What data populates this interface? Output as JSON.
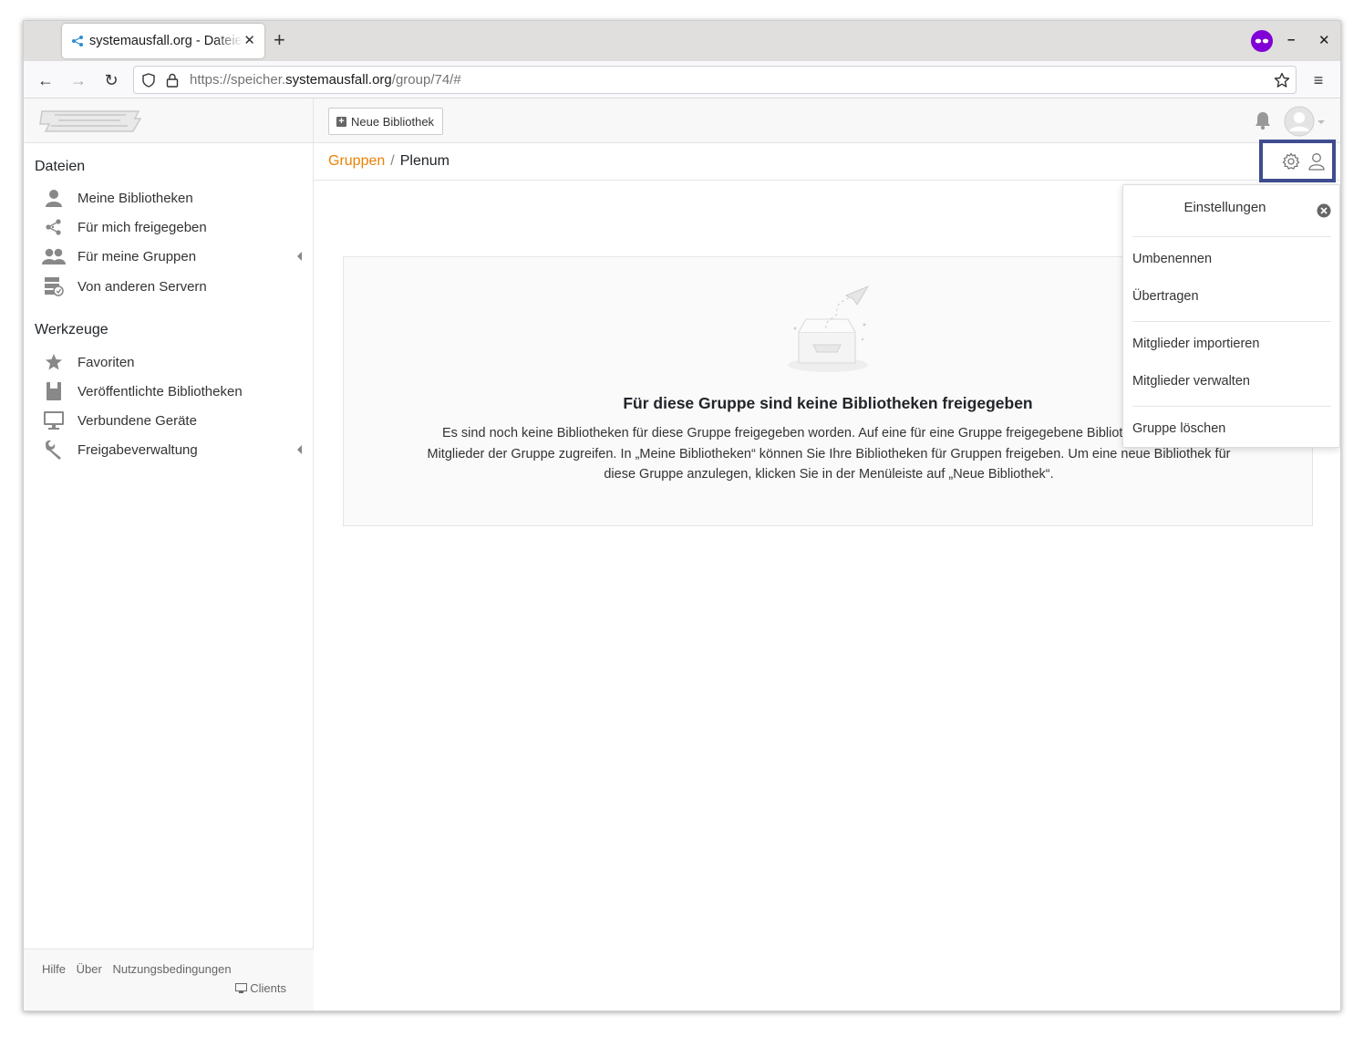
{
  "browser": {
    "tab_title": "systemausfall.org - Dateien",
    "url_prefix": "https://speicher.",
    "url_host": "systemausfall.org",
    "url_path": "/group/74/#"
  },
  "topbar": {
    "logo_alt": "systemausfall",
    "new_library_label": "Neue Bibliothek"
  },
  "sidebar": {
    "files_heading": "Dateien",
    "files_items": [
      {
        "label": "Meine Bibliotheken",
        "icon": "user-icon"
      },
      {
        "label": "Für mich freigegeben",
        "icon": "share-icon"
      },
      {
        "label": "Für meine Gruppen",
        "icon": "group-icon"
      },
      {
        "label": "Von anderen Servern",
        "icon": "server-icon"
      }
    ],
    "tools_heading": "Werkzeuge",
    "tools_items": [
      {
        "label": "Favoriten",
        "icon": "star-icon"
      },
      {
        "label": "Veröffentlichte Bibliotheken",
        "icon": "book-icon"
      },
      {
        "label": "Verbundene Geräte",
        "icon": "monitor-icon"
      },
      {
        "label": "Freigabeverwaltung",
        "icon": "wrench-icon"
      }
    ],
    "footer": {
      "help": "Hilfe",
      "about": "Über",
      "terms": "Nutzungsbedingungen",
      "clients": "Clients"
    }
  },
  "breadcrumb": {
    "parent": "Gruppen",
    "separator": "/",
    "current": "Plenum"
  },
  "empty_state": {
    "title": "Für diese Gruppe sind keine Bibliotheken freigegeben",
    "description": "Es sind noch keine Bibliotheken für diese Gruppe freigegeben worden. Auf eine für eine Gruppe freigegebene Bibliothek können alle Mitglieder der Gruppe zugreifen. In „Meine Bibliotheken“ können Sie Ihre Bibliotheken für Gruppen freigeben. Um eine neue Bibliothek für diese Gruppe anzulegen, klicken Sie in der Menüleiste auf „Neue Bibliothek“."
  },
  "settings_popover": {
    "title": "Einstellungen",
    "items": [
      "Umbenennen",
      "Übertragen",
      "Mitglieder importieren",
      "Mitglieder verwalten",
      "Gruppe löschen"
    ]
  },
  "colors": {
    "accent": "#eb8205",
    "highlight_border": "#3f4c8f"
  }
}
